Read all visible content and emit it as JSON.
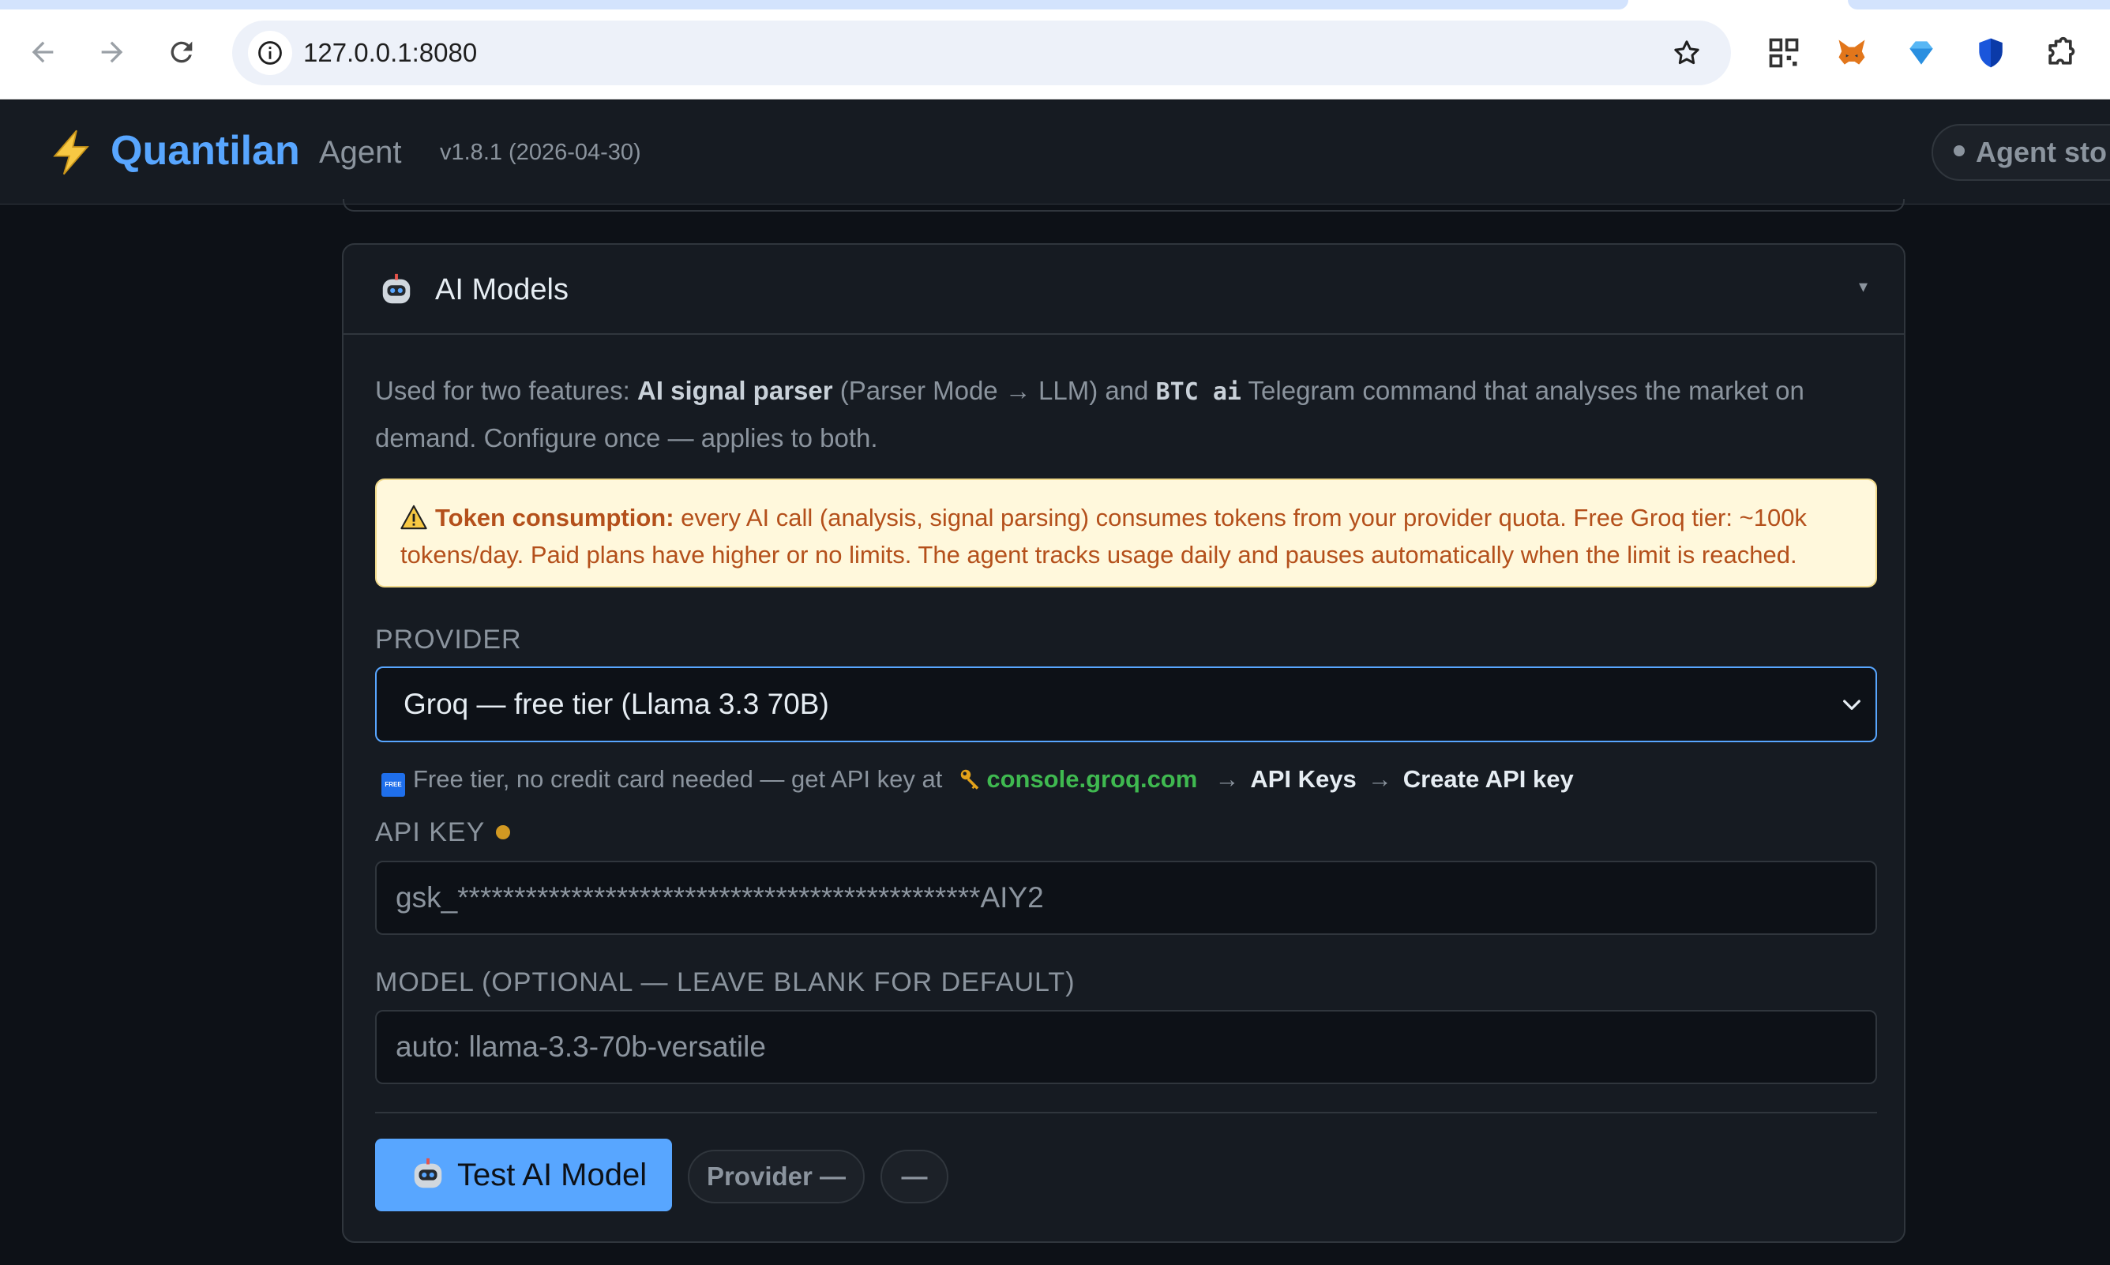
{
  "browser": {
    "url": "127.0.0.1:8080",
    "icons": [
      "back-icon",
      "forward-icon",
      "reload-icon",
      "site-info-icon",
      "bookmark-star-icon",
      "qr-extension-icon",
      "metamask-fox-icon",
      "diamond-extension-icon",
      "shield-extension-icon",
      "extensions-puzzle-icon"
    ]
  },
  "header": {
    "brand": "Quantilan",
    "subtitle": "Agent",
    "version": "v1.8.1 (2026-04-30)",
    "agent_status": "Agent sto"
  },
  "card": {
    "title": "AI Models",
    "collapse": "▾",
    "description": {
      "p1": "Used for two features: ",
      "b1": "AI signal parser",
      "p2": " (Parser Mode → LLM) and ",
      "code": "BTC ai",
      "p3": " Telegram command that analyses the market on demand. Configure once — applies to both."
    },
    "warning": {
      "title": "Token consumption:",
      "body": " every AI call (analysis, signal parsing) consumes tokens from your provider quota. Free Groq tier: ~100k tokens/day. Paid plans have higher or no limits. The agent tracks usage daily and pauses automatically when the limit is reached."
    },
    "provider": {
      "label": "PROVIDER",
      "selected": "Groq — free tier (Llama 3.3 70B)",
      "hint_badge": "FREE",
      "hint_text": "Free tier, no credit card needed — get API key at",
      "hint_link": "console.groq.com",
      "hint_arrow": "→",
      "hint_step1": "API Keys",
      "hint_step2": "Create API key"
    },
    "api_key": {
      "label": "API KEY",
      "value": "gsk_**********************************************AIY2"
    },
    "model": {
      "label": "MODEL",
      "label_note": " (OPTIONAL — LEAVE BLANK FOR DEFAULT)",
      "placeholder": "auto: llama-3.3-70b-versatile"
    },
    "actions": {
      "test_button": "Test AI Model",
      "provider_pill": "Provider —",
      "status_pill": "—"
    }
  },
  "colors": {
    "accent": "#58a6ff",
    "background": "#0d1117",
    "panel": "#161b22",
    "warning_bg": "#fff8dc",
    "warning_text": "#b4501b",
    "link_green": "#3fb950",
    "status_amber": "#d29922"
  }
}
